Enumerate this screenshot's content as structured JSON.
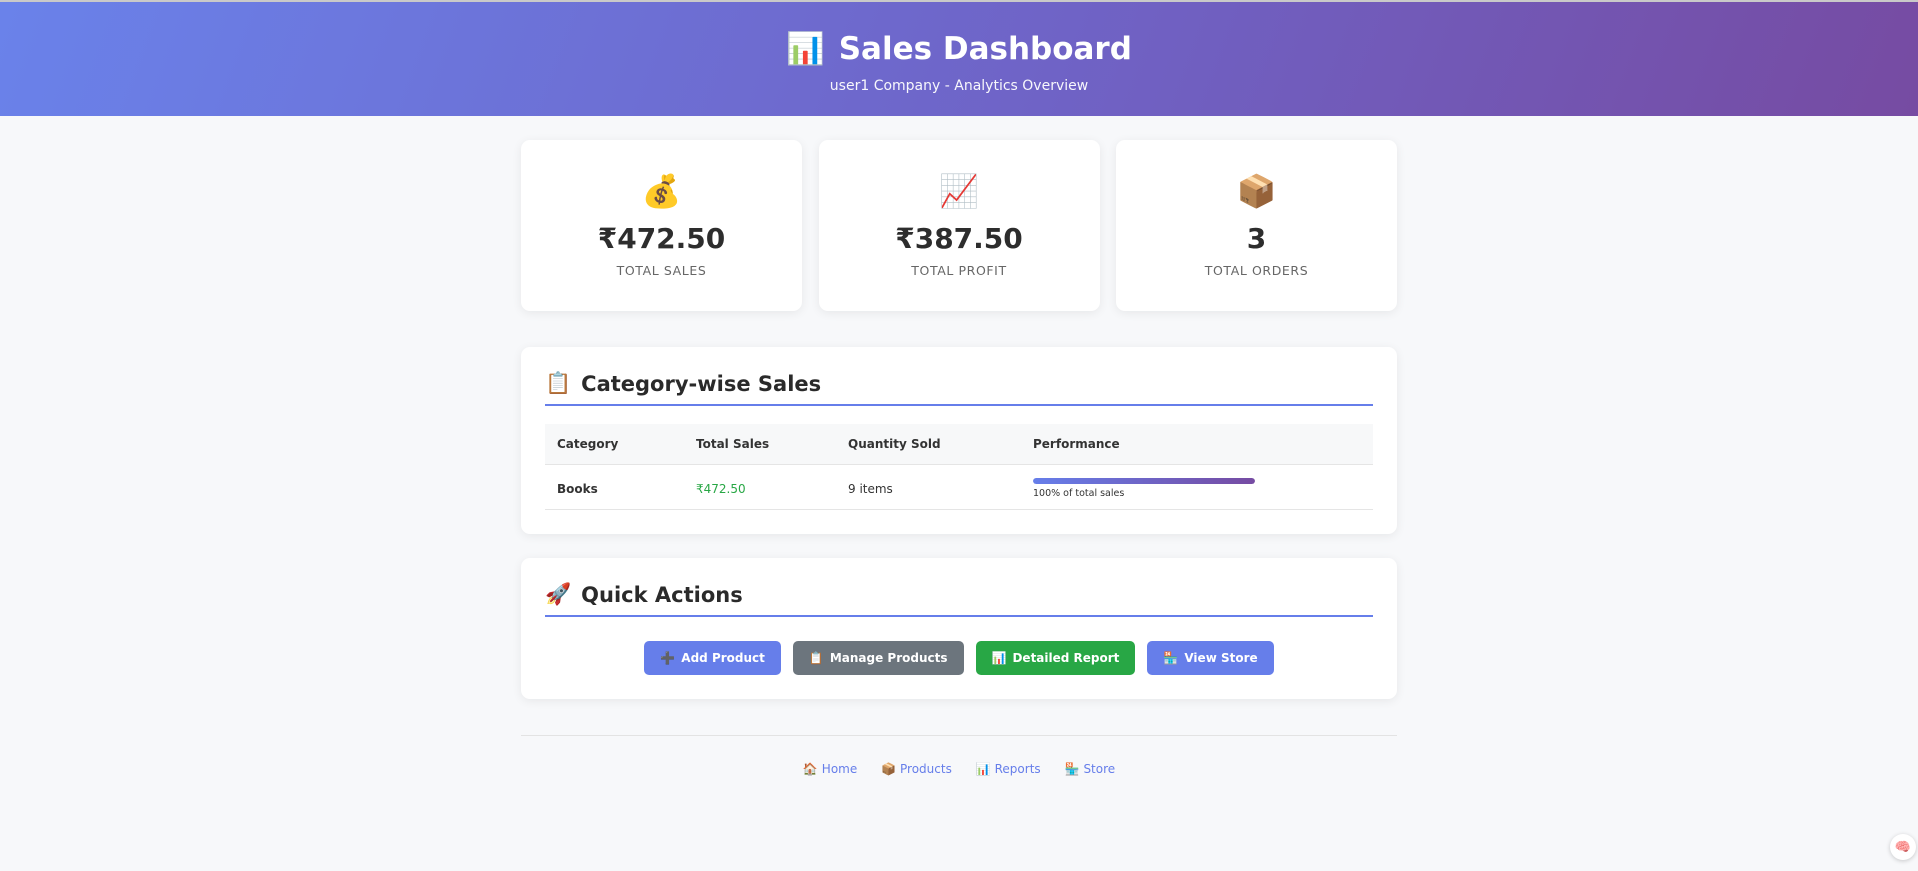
{
  "header": {
    "icon": "bar-chart-icon",
    "icon_glyph": "📊",
    "title": "Sales Dashboard",
    "subtitle": "user1 Company - Analytics Overview"
  },
  "stats": [
    {
      "icon": "money-bag-icon",
      "glyph": "💰",
      "value": "₹472.50",
      "label": "Total Sales"
    },
    {
      "icon": "chart-increasing-icon",
      "glyph": "📈",
      "value": "₹387.50",
      "label": "Total Profit"
    },
    {
      "icon": "package-icon",
      "glyph": "📦",
      "value": "3",
      "label": "Total Orders"
    }
  ],
  "category_section": {
    "icon": "clipboard-icon",
    "icon_glyph": "📋",
    "title": "Category-wise Sales",
    "columns": [
      "Category",
      "Total Sales",
      "Quantity Sold",
      "Performance"
    ],
    "rows": [
      {
        "category": "Books",
        "total_sales": "₹472.50",
        "quantity": "9 items",
        "performance_fraction": 1.0,
        "performance_label": "100% of total sales"
      }
    ]
  },
  "quick_actions": {
    "icon": "rocket-icon",
    "icon_glyph": "🚀",
    "title": "Quick Actions",
    "buttons": [
      {
        "label": "Add Product",
        "icon": "plus-icon",
        "glyph": "➕",
        "color": "#667eea"
      },
      {
        "label": "Manage Products",
        "icon": "clipboard-icon",
        "glyph": "📋",
        "color": "#6c757d"
      },
      {
        "label": "Detailed Report",
        "icon": "bar-chart-icon",
        "glyph": "📊",
        "color": "#28a745"
      },
      {
        "label": "View Store",
        "icon": "store-icon",
        "glyph": "🏪",
        "color": "#667eea"
      }
    ]
  },
  "footer": {
    "links": [
      {
        "label": "Home",
        "icon": "house-icon",
        "glyph": "🏠"
      },
      {
        "label": "Products",
        "icon": "package-icon",
        "glyph": "📦"
      },
      {
        "label": "Reports",
        "icon": "bar-chart-icon",
        "glyph": "📊"
      },
      {
        "label": "Store",
        "icon": "store-icon",
        "glyph": "🏪"
      }
    ]
  },
  "colors": {
    "accent": "#667eea",
    "accent_dark": "#764ba2",
    "success": "#28a745",
    "secondary": "#6c757d"
  },
  "floating_button": {
    "icon": "brain-icon",
    "glyph": "🧠"
  }
}
